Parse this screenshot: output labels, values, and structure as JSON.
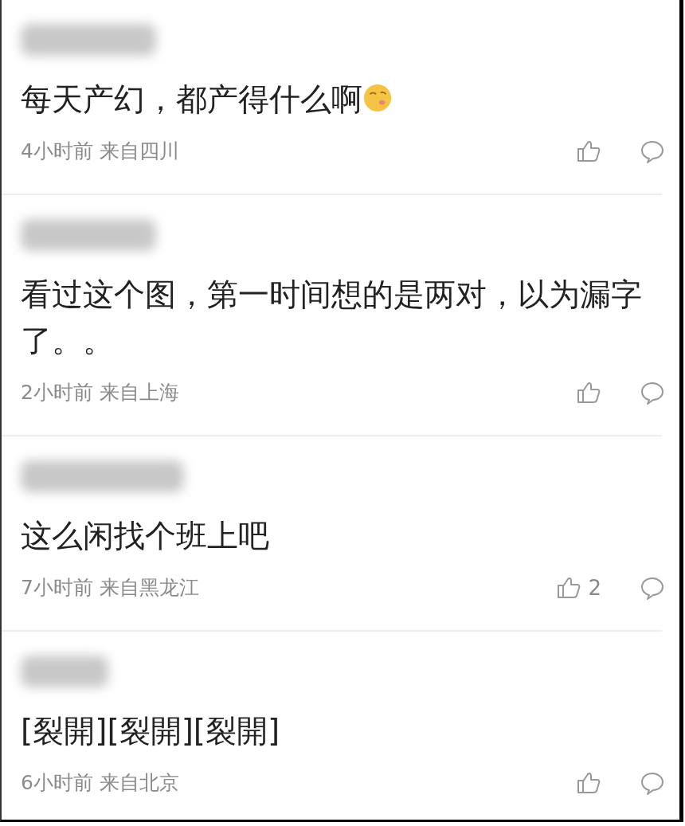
{
  "comments": [
    {
      "text": "每天产幻，都产得什么啊",
      "emoji": true,
      "meta": "4小时前 来自四川"
    },
    {
      "text": "看过这个图，第一时间想的是两对，以为漏字了。。",
      "emoji": false,
      "meta": "2小时前 来自上海"
    },
    {
      "text": "这么闲找个班上吧",
      "emoji": false,
      "meta": "7小时前 来自黑龙江",
      "likes": "2"
    },
    {
      "text": "[裂開][裂開][裂開]",
      "emoji": false,
      "meta": "6小时前 来自北京"
    }
  ]
}
